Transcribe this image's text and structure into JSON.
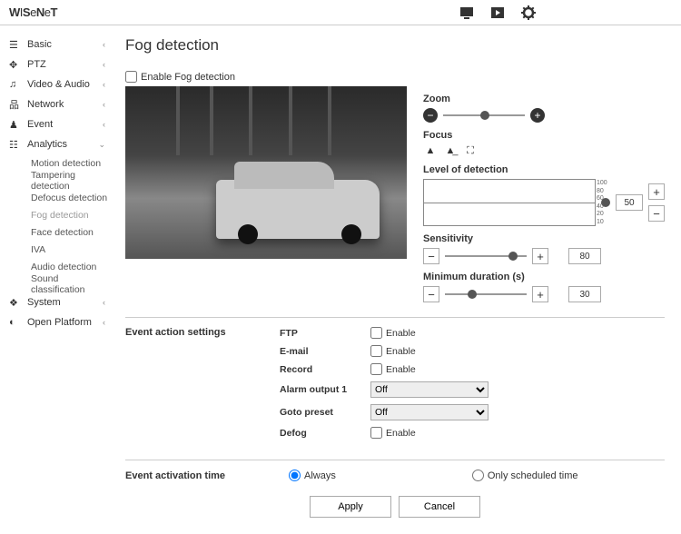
{
  "brand": "WISeNeT",
  "sidebar": {
    "basic": "Basic",
    "ptz": "PTZ",
    "va": "Video & Audio",
    "network": "Network",
    "event": "Event",
    "analytics": "Analytics",
    "analytics_items": {
      "motion": "Motion detection",
      "tampering": "Tampering detection",
      "defocus": "Defocus detection",
      "fog": "Fog detection",
      "face": "Face detection",
      "iva": "IVA",
      "audio": "Audio detection",
      "sound": "Sound classification"
    },
    "system": "System",
    "open": "Open Platform"
  },
  "page": {
    "title": "Fog detection",
    "enable_label": "Enable Fog detection"
  },
  "controls": {
    "zoom_label": "Zoom",
    "focus_label": "Focus",
    "level_label": "Level of detection",
    "level_val": "50",
    "sens_label": "Sensitivity",
    "sens_val": "80",
    "mindur_label": "Minimum duration (s)",
    "mindur_val": "30",
    "scale": {
      "s100": "100",
      "s80": "80",
      "s60": "60",
      "s40": "40",
      "s20": "20",
      "s10": "10"
    }
  },
  "event_actions": {
    "section": "Event action settings",
    "ftp": "FTP",
    "email": "E-mail",
    "record": "Record",
    "alarm": "Alarm output 1",
    "goto": "Goto preset",
    "defog": "Defog",
    "enable": "Enable",
    "off": "Off"
  },
  "activation": {
    "section": "Event activation time",
    "always": "Always",
    "sched": "Only scheduled time"
  },
  "buttons": {
    "apply": "Apply",
    "cancel": "Cancel"
  }
}
